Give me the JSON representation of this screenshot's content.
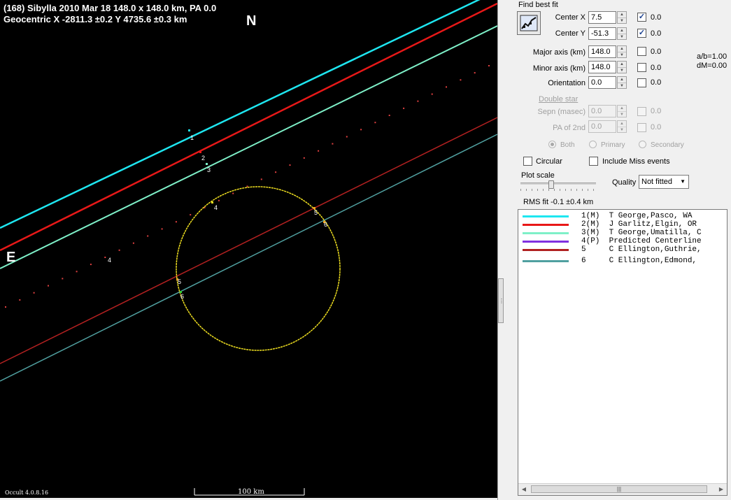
{
  "plot": {
    "title_line1": "(168) Sibylla  2010 Mar 18   148.0 x 148.0 km,  PA 0.0",
    "title_line2": "Geocentric  X  -2811.3 ±0.2  Y 4735.6 ±0.3 km",
    "north_label": "N",
    "east_label": "E",
    "version": "Occult 4.0.8.16",
    "scale_label": "100 km",
    "chord_labels": [
      "1",
      "2",
      "3",
      "4",
      "4",
      "5",
      "6",
      "5",
      "6"
    ],
    "colors": {
      "chord1": "#1ee6f0",
      "chord2": "#e81818",
      "chord3": "#7ef0c8",
      "predicted": "#e04040",
      "chord5": "#b02020",
      "chord6": "#50a0a0",
      "asteroid": "#f0e020"
    }
  },
  "panel": {
    "find_best_fit": "Find best fit",
    "fit_button_icon": "chart-fit-icon",
    "center_x": {
      "label": "Center X",
      "value": "7.5",
      "fit_checked": true,
      "uncertainty": "0.0"
    },
    "center_y": {
      "label": "Center Y",
      "value": "-51.3",
      "fit_checked": true,
      "uncertainty": "0.0"
    },
    "major_axis": {
      "label": "Major axis (km)",
      "value": "148.0",
      "fit_checked": false,
      "uncertainty": "0.0"
    },
    "minor_axis": {
      "label": "Minor axis (km)",
      "value": "148.0",
      "fit_checked": false,
      "uncertainty": "0.0"
    },
    "orientation": {
      "label": "Orientation",
      "value": "0.0",
      "fit_checked": false,
      "uncertainty": "0.0"
    },
    "ratio_ab": "a/b=1.00",
    "ratio_dm": "dM=0.00",
    "double_star": "Double star",
    "sepn": {
      "label": "Sepn (masec)",
      "value": "0.0",
      "uncertainty": "0.0"
    },
    "pa2": {
      "label": "PA of 2nd",
      "value": "0.0",
      "uncertainty": "0.0"
    },
    "radio_both": "Both",
    "radio_primary": "Primary",
    "radio_secondary": "Secondary",
    "circular": "Circular",
    "include_miss": "Include Miss events",
    "plot_scale": "Plot scale",
    "quality_label": "Quality",
    "quality_value": "Not fitted",
    "rms_fit": "RMS fit -0.1 ±0.4 km",
    "legend": [
      {
        "text": "1(M)  T George,Pasco, WA",
        "color": "#1ee6f0"
      },
      {
        "text": "2(M)  J Garlitz,Elgin, OR",
        "color": "#e81818"
      },
      {
        "text": "3(M)  T George,Umatilla, C",
        "color": "#7ef0c8"
      },
      {
        "text": "4(P)  Predicted Centerline",
        "color": "#8030e0"
      },
      {
        "text": "5     C Ellington,Guthrie,",
        "color": "#b02020"
      },
      {
        "text": "6     C Ellington,Edmond,",
        "color": "#50a0a0"
      }
    ]
  }
}
